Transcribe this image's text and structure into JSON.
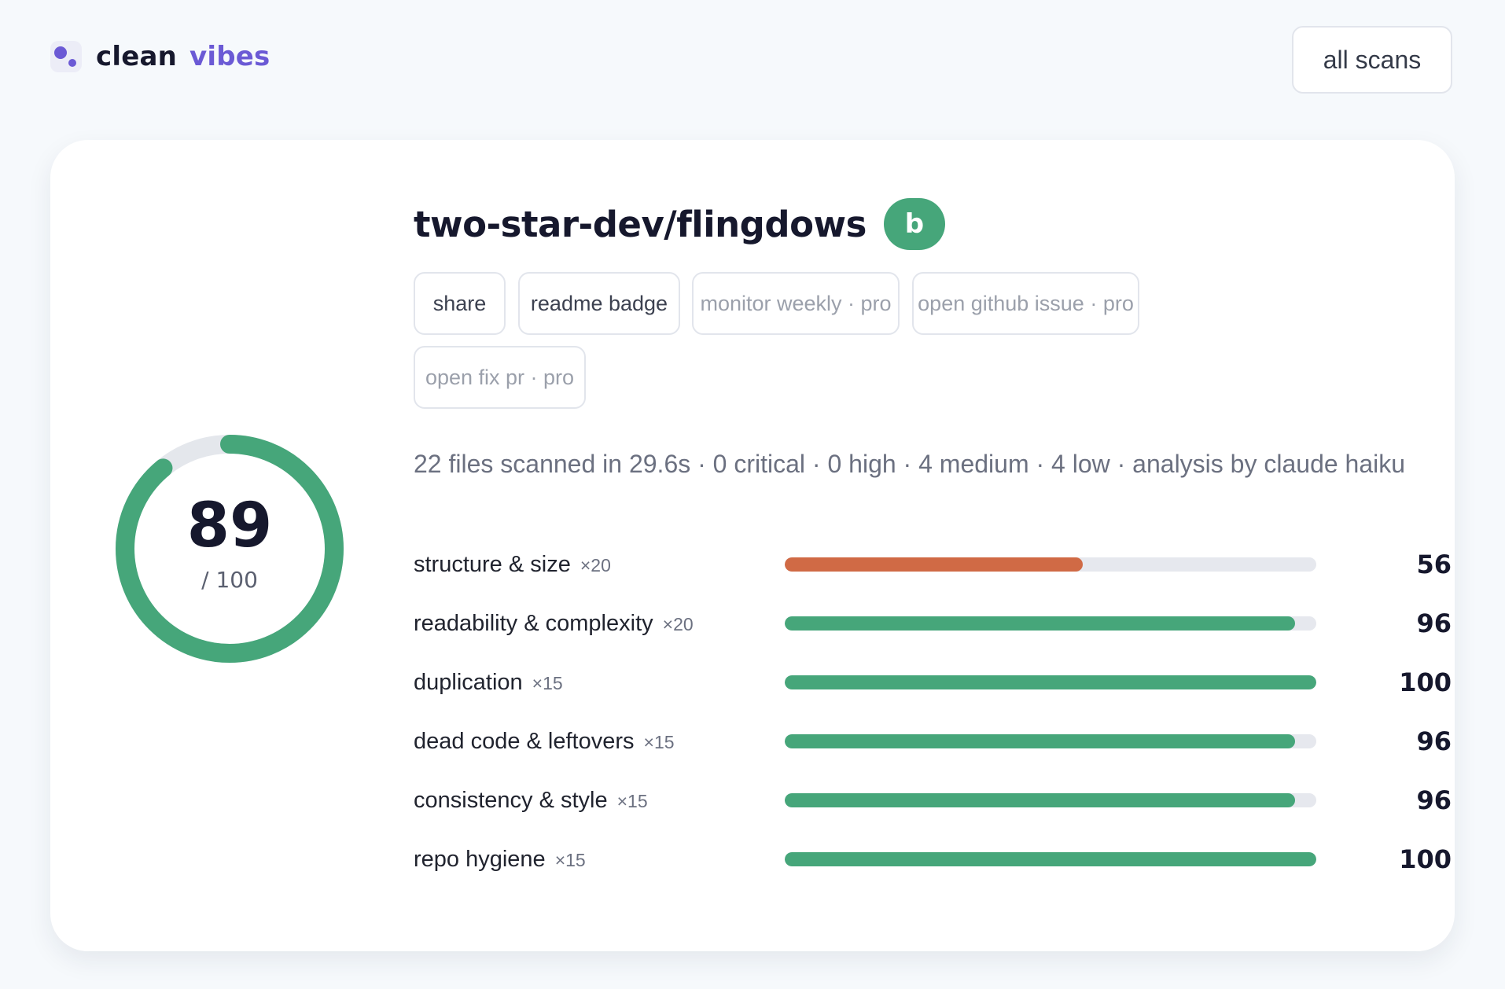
{
  "header": {
    "brand_word_1": "clean",
    "brand_word_2": "vibes",
    "brand_color": "#6b5ad5",
    "logo_icon": "logo-dots-icon",
    "all_scans_label": "all scans"
  },
  "report": {
    "repo": "two-star-dev/flingdows",
    "grade": "b",
    "grade_color": "#46a67a",
    "score": "89",
    "score_max": "/ 100",
    "score_fraction": 0.89,
    "actions": [
      {
        "label": "share",
        "pro": false
      },
      {
        "label": "readme badge",
        "pro": false
      },
      {
        "label": "monitor weekly · pro",
        "pro": true
      },
      {
        "label": "open github issue · pro",
        "pro": true
      },
      {
        "label": "open fix pr · pro",
        "pro": true
      }
    ],
    "summary": "22 files scanned in 29.6s · 0 critical · 0 high · 4 medium · 4 low · analysis by claude haiku",
    "metrics": [
      {
        "label": "structure & size",
        "weight": "×20",
        "value": "56",
        "score": 56,
        "color": "#d06a45"
      },
      {
        "label": "readability & complexity",
        "weight": "×20",
        "value": "96",
        "score": 96,
        "color": "#46a67a"
      },
      {
        "label": "duplication",
        "weight": "×15",
        "value": "100",
        "score": 100,
        "color": "#46a67a"
      },
      {
        "label": "dead code & leftovers",
        "weight": "×15",
        "value": "96",
        "score": 96,
        "color": "#46a67a"
      },
      {
        "label": "consistency & style",
        "weight": "×15",
        "value": "96",
        "score": 96,
        "color": "#46a67a"
      },
      {
        "label": "repo hygiene",
        "weight": "×15",
        "value": "100",
        "score": 100,
        "color": "#46a67a"
      }
    ]
  }
}
